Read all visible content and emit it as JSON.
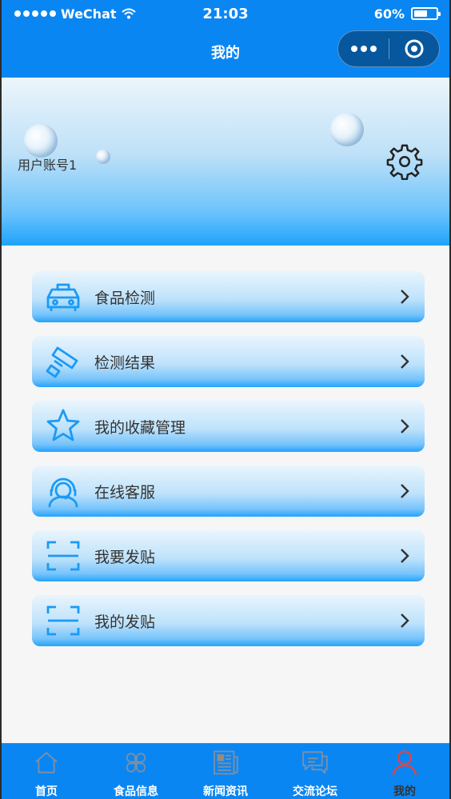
{
  "status_bar": {
    "carrier": "WeChat",
    "time": "21:03",
    "battery": "60%",
    "battery_level": 0.6
  },
  "nav": {
    "title": "我的"
  },
  "profile": {
    "username": "用户账号1"
  },
  "menu": [
    {
      "label": "食品检测",
      "icon": "car-icon"
    },
    {
      "label": "检测结果",
      "icon": "tape-icon"
    },
    {
      "label": "我的收藏管理",
      "icon": "star-icon"
    },
    {
      "label": "在线客服",
      "icon": "headset-icon"
    },
    {
      "label": "我要发贴",
      "icon": "scan-icon"
    },
    {
      "label": "我的发贴",
      "icon": "scan-icon"
    }
  ],
  "tabs": [
    {
      "label": "首页",
      "icon": "home-icon"
    },
    {
      "label": "食品信息",
      "icon": "clover-icon"
    },
    {
      "label": "新闻资讯",
      "icon": "newspaper-icon"
    },
    {
      "label": "交流论坛",
      "icon": "chat-icon"
    },
    {
      "label": "我的",
      "icon": "person-icon"
    }
  ],
  "colors": {
    "primary": "#0a86f2",
    "icon_blue": "#1a9af5",
    "active_tab": "#e64340"
  }
}
